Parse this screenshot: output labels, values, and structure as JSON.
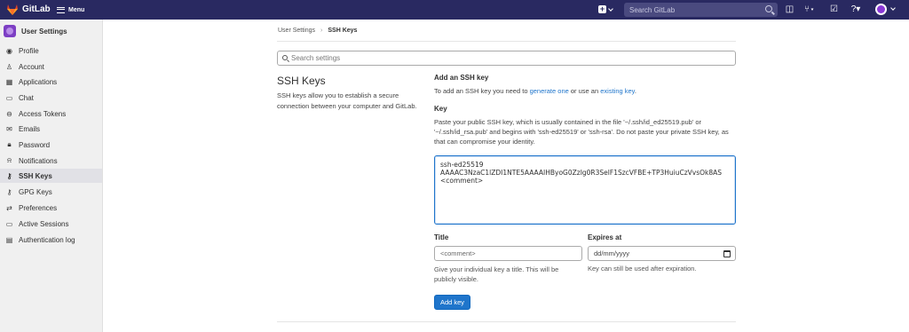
{
  "topbar": {
    "brand": "GitLab",
    "menu_label": "Menu",
    "search_placeholder": "Search GitLab",
    "icons": [
      "plus-icon",
      "issues-icon",
      "merge-request-icon",
      "todo-icon",
      "help-icon",
      "avatar"
    ]
  },
  "sidebar": {
    "title": "User Settings",
    "items": [
      {
        "label": "Profile",
        "icon": "profile-icon"
      },
      {
        "label": "Account",
        "icon": "account-icon"
      },
      {
        "label": "Applications",
        "icon": "applications-icon"
      },
      {
        "label": "Chat",
        "icon": "chat-icon"
      },
      {
        "label": "Access Tokens",
        "icon": "token-icon"
      },
      {
        "label": "Emails",
        "icon": "email-icon"
      },
      {
        "label": "Password",
        "icon": "lock-icon"
      },
      {
        "label": "Notifications",
        "icon": "bell-icon"
      },
      {
        "label": "SSH Keys",
        "icon": "key-icon",
        "active": true
      },
      {
        "label": "GPG Keys",
        "icon": "key-icon"
      },
      {
        "label": "Preferences",
        "icon": "preferences-icon"
      },
      {
        "label": "Active Sessions",
        "icon": "monitor-icon"
      },
      {
        "label": "Authentication log",
        "icon": "log-icon"
      }
    ]
  },
  "breadcrumb": {
    "parent": "User Settings",
    "separator": "›",
    "current": "SSH Keys"
  },
  "settings_search": {
    "placeholder": "Search settings"
  },
  "section": {
    "title": "SSH Keys",
    "description": "SSH keys allow you to establish a secure connection between your computer and GitLab."
  },
  "add_key": {
    "title": "Add an SSH key",
    "desc_prefix": "To add an SSH key you need to ",
    "link1": "generate one",
    "desc_middle": " or use an ",
    "link2": "existing key",
    "desc_suffix": "."
  },
  "key": {
    "label": "Key",
    "help": "Paste your public SSH key, which is usually contained in the file '~/.ssh/id_ed25519.pub' or '~/.ssh/id_rsa.pub' and begins with 'ssh-ed25519' or 'ssh-rsa'. Do not paste your private SSH key, as that can compromise your identity.",
    "value": "ssh-ed25519 AAAAC3NzaC1lZDI1NTE5AAAAIHByoG0ZzIg0R3SelF1SzcVFBE+TP3HuiuCzVvsOk8AS\n<comment>"
  },
  "title_field": {
    "label": "Title",
    "value": "<comment>",
    "help": "Give your individual key a title. This will be publicly visible."
  },
  "expires": {
    "label": "Expires at",
    "value": "dd/mm/yyyy",
    "help": "Key can still be used after expiration."
  },
  "submit_label": "Add key"
}
